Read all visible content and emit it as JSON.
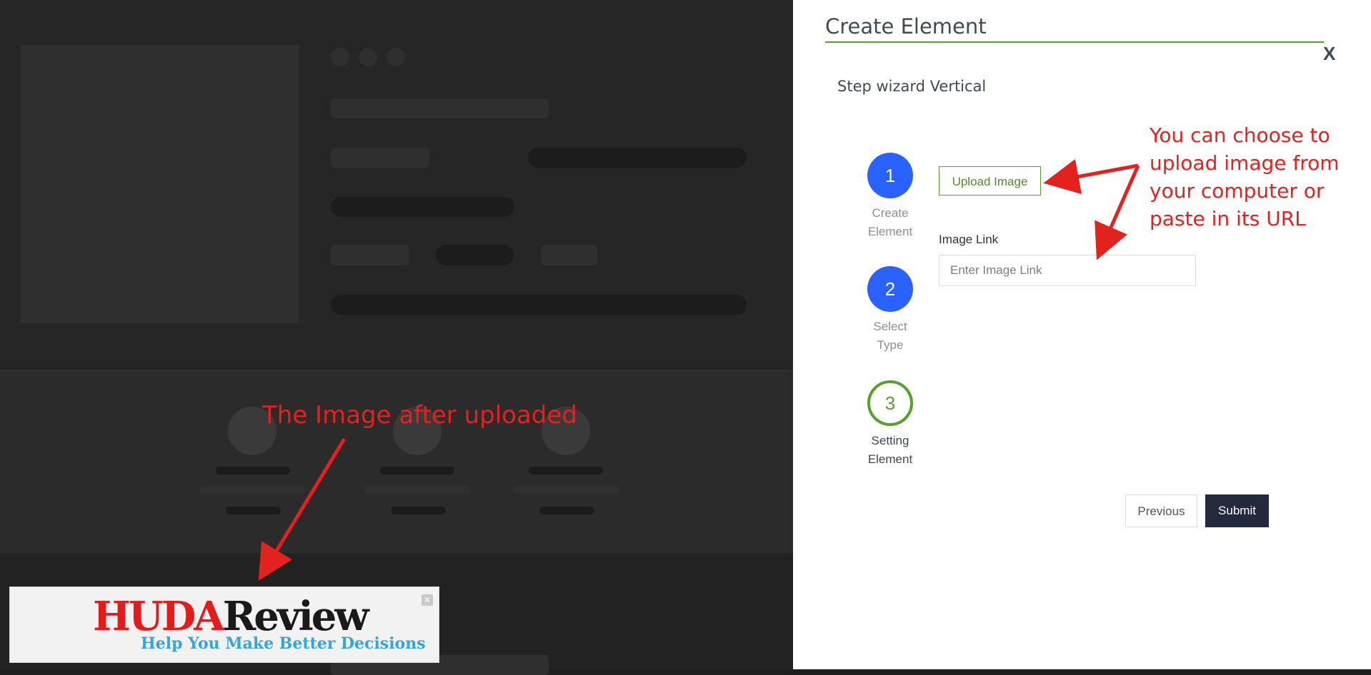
{
  "annotations": {
    "left": "The Image after uploaded",
    "right": "You can choose to upload image from your computer or paste in its URL"
  },
  "ad": {
    "logo_part1": "HUDA",
    "logo_part2": "Review",
    "tagline": "Help You Make Better Decisions",
    "close_glyph": "✕"
  },
  "modal": {
    "title": "Create Element",
    "close_label": "X",
    "wizard_title": "Step wizard Vertical",
    "steps": [
      {
        "number": "1",
        "line1": "Create",
        "line2": "Element"
      },
      {
        "number": "2",
        "line1": "Select",
        "line2": "Type"
      },
      {
        "number": "3",
        "line1": "Setting",
        "line2": "Element"
      }
    ],
    "upload_button": "Upload Image",
    "image_link_label": "Image Link",
    "image_link_placeholder": "Enter Image Link",
    "image_link_value": "",
    "previous_button": "Previous",
    "submit_button": "Submit"
  },
  "colors": {
    "step_active": "#2962ff",
    "step_current_outline": "#57a12a",
    "accent_green": "#57a12a",
    "annotation_red": "#e3211d",
    "submit_bg": "#232a3d"
  }
}
